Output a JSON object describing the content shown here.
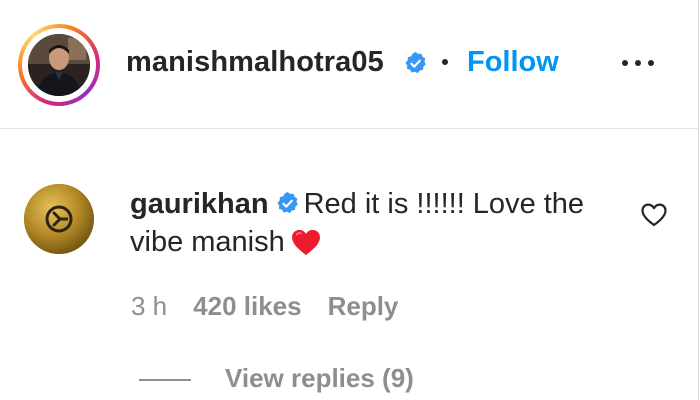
{
  "header": {
    "username": "manishmalhotra05",
    "separator": "•",
    "follow_label": "Follow",
    "more_label": "•••"
  },
  "comment": {
    "username": "gaurikhan",
    "text": "Red it is !!!!!! Love the vibe manish",
    "emoji": "red-heart-emoji",
    "time": "3 h",
    "likes": "420 likes",
    "reply_label": "Reply",
    "view_replies_label": "View replies (9)"
  },
  "colors": {
    "accent": "#0095f6",
    "verified": "#3897f0",
    "muted": "#8e8e8e",
    "text": "#262626",
    "heart": "#ed1b2e",
    "divider": "#e3e3e3"
  },
  "icons": {
    "verified": "verified-badge-icon",
    "like": "heart-outline-icon",
    "more": "more-options-icon"
  }
}
